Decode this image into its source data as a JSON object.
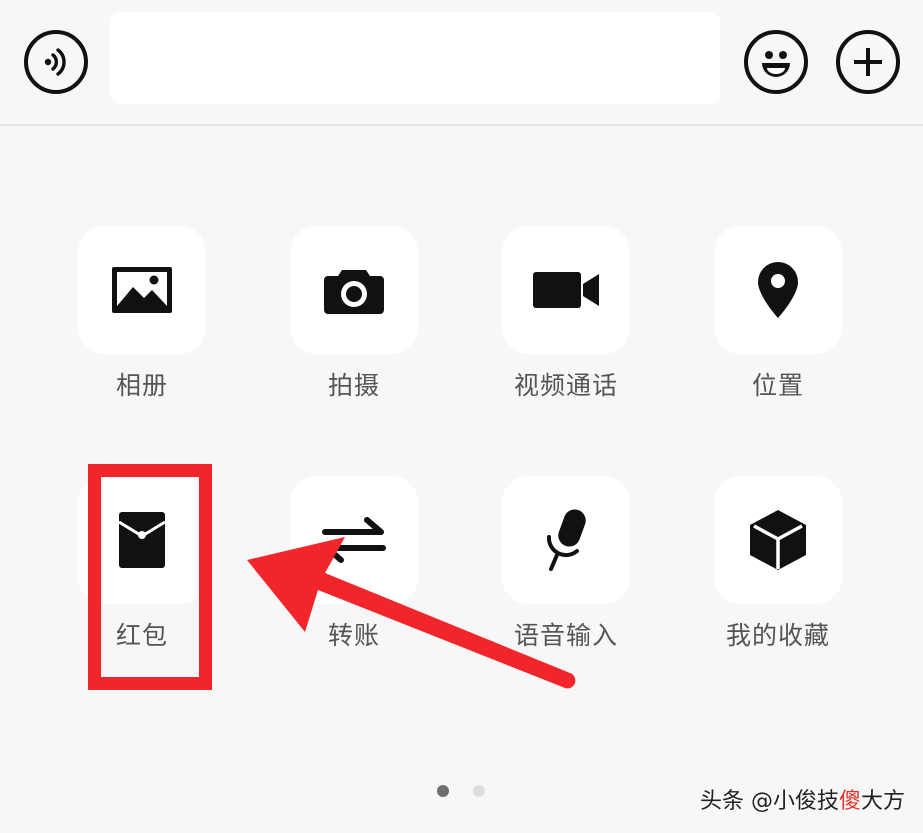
{
  "input_bar": {
    "voice_icon": "voice-icon",
    "emoji_icon": "emoji-icon",
    "plus_icon": "plus-icon",
    "text_value": ""
  },
  "panel": {
    "items": [
      {
        "label": "相册",
        "icon": "photo-icon"
      },
      {
        "label": "拍摄",
        "icon": "camera-icon"
      },
      {
        "label": "视频通话",
        "icon": "video-call-icon"
      },
      {
        "label": "位置",
        "icon": "location-pin-icon"
      },
      {
        "label": "红包",
        "icon": "red-packet-icon"
      },
      {
        "label": "转账",
        "icon": "transfer-icon"
      },
      {
        "label": "语音输入",
        "icon": "microphone-icon"
      },
      {
        "label": "我的收藏",
        "icon": "favorites-cube-icon"
      }
    ]
  },
  "pagination": {
    "current_page": 1,
    "total_pages": 2
  },
  "annotation": {
    "highlight_color": "#f2262a",
    "highlighted_item": "红包"
  },
  "watermark": {
    "text_prefix": "头条 @小俊技",
    "text_highlight": "傻",
    "text_suffix": "大方",
    "highlight_color": "#e8332b"
  }
}
